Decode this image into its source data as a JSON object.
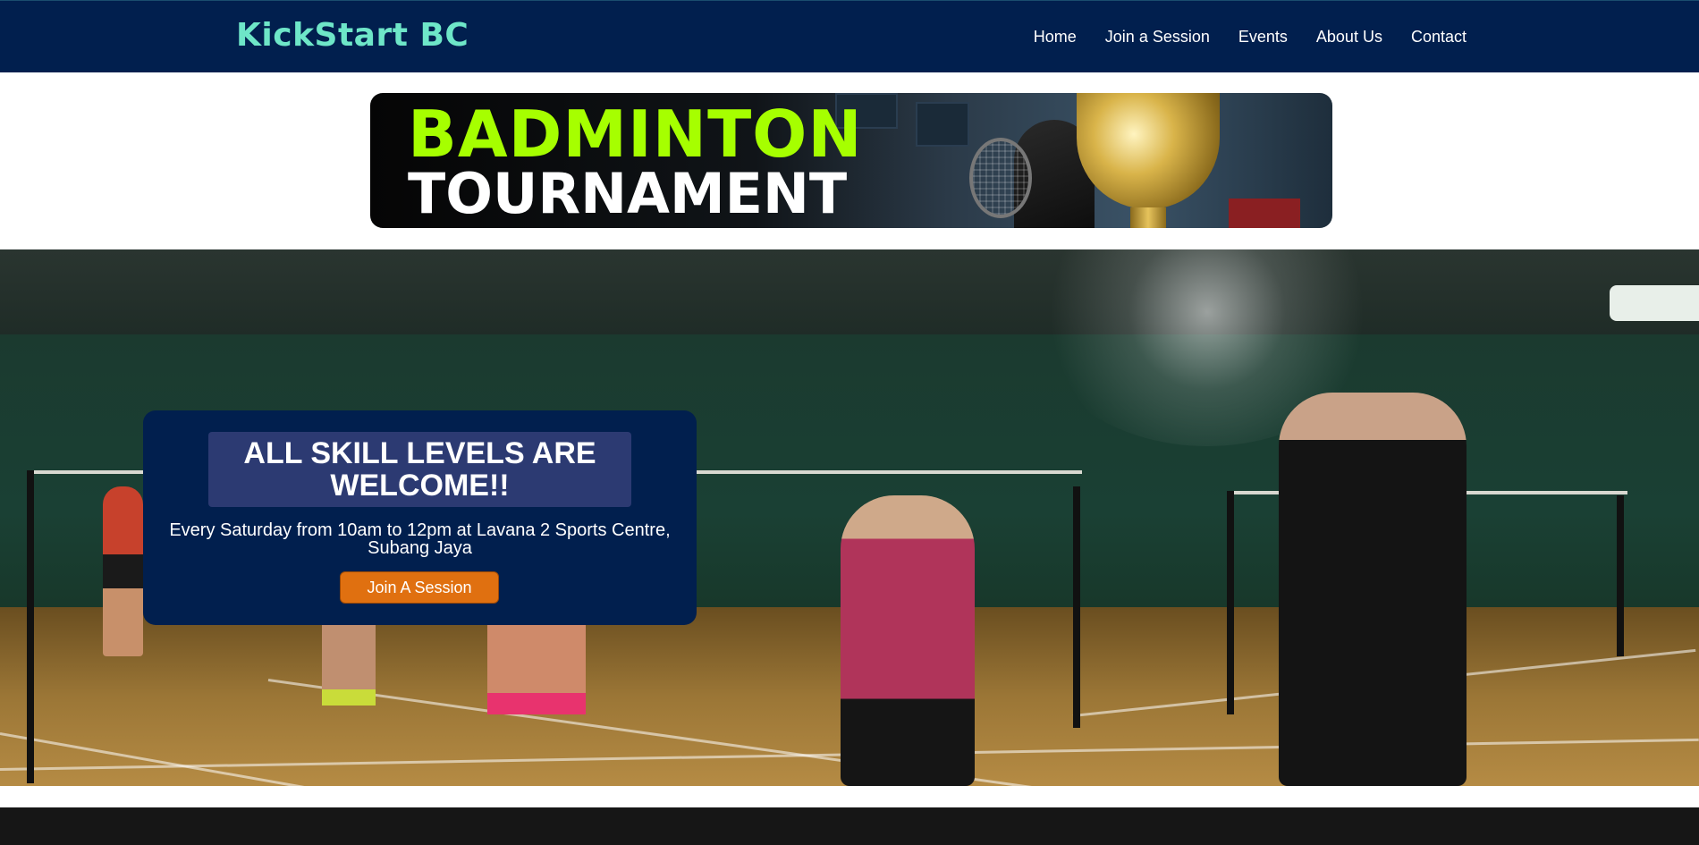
{
  "navbar": {
    "logo": "KickStart BC",
    "links": [
      "Home",
      "Join a Session",
      "Events",
      "About Us",
      "Contact"
    ]
  },
  "banner": {
    "line1": "BADMINTON",
    "line2": "TOURNAMENT"
  },
  "hero": {
    "title": "ALL SKILL LEVELS ARE WELCOME!!",
    "subtitle": "Every Saturday from 10am to 12pm at Lavana 2 Sports Centre, Subang Jaya",
    "button_label": "Join A Session"
  },
  "colors": {
    "navbar_bg": "#011f4e",
    "logo": "#6ee6c8",
    "banner_accent": "#a6ff00",
    "button": "#e07010"
  }
}
